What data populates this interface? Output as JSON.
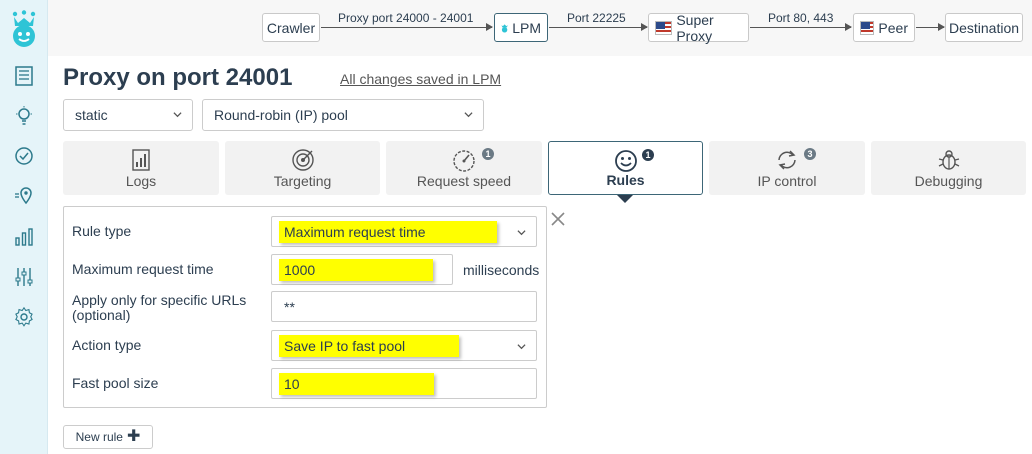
{
  "flow": {
    "nodes": [
      "Crawler",
      "LPM",
      "Super Proxy",
      "Peer",
      "Destination"
    ],
    "edges": [
      "Proxy port 24000 - 24001",
      "Port 22225",
      "Port 80, 443"
    ]
  },
  "header": {
    "title": "Proxy on port 24001",
    "saved_link": "All changes saved in LPM"
  },
  "selects": {
    "session": "static",
    "pool": "Round-robin (IP) pool"
  },
  "tabs": [
    {
      "label": "Logs",
      "icon": "logs-icon",
      "badge": ""
    },
    {
      "label": "Targeting",
      "icon": "target-icon",
      "badge": ""
    },
    {
      "label": "Request speed",
      "icon": "speedometer-icon",
      "badge": "1"
    },
    {
      "label": "Rules",
      "icon": "smiley-icon",
      "badge": "1"
    },
    {
      "label": "IP control",
      "icon": "refresh-icon",
      "badge": "3"
    },
    {
      "label": "Debugging",
      "icon": "bug-icon",
      "badge": ""
    }
  ],
  "rule": {
    "rule_type_label": "Rule type",
    "rule_type_value": "Maximum request time",
    "max_time_label": "Maximum request time",
    "max_time_value": "1000",
    "max_time_unit": "milliseconds",
    "urls_label_1": "Apply only for specific URLs",
    "urls_label_2": "(optional)",
    "urls_value": "**",
    "action_label": "Action type",
    "action_value": "Save IP to fast pool",
    "pool_size_label": "Fast pool size",
    "pool_size_value": "10"
  },
  "new_rule_label": "New rule",
  "colors": {
    "accent": "#2c3e50",
    "highlight": "#ffff00",
    "sidebar_bg": "#e5f4f9",
    "brand_teal": "#2ec4d6"
  }
}
